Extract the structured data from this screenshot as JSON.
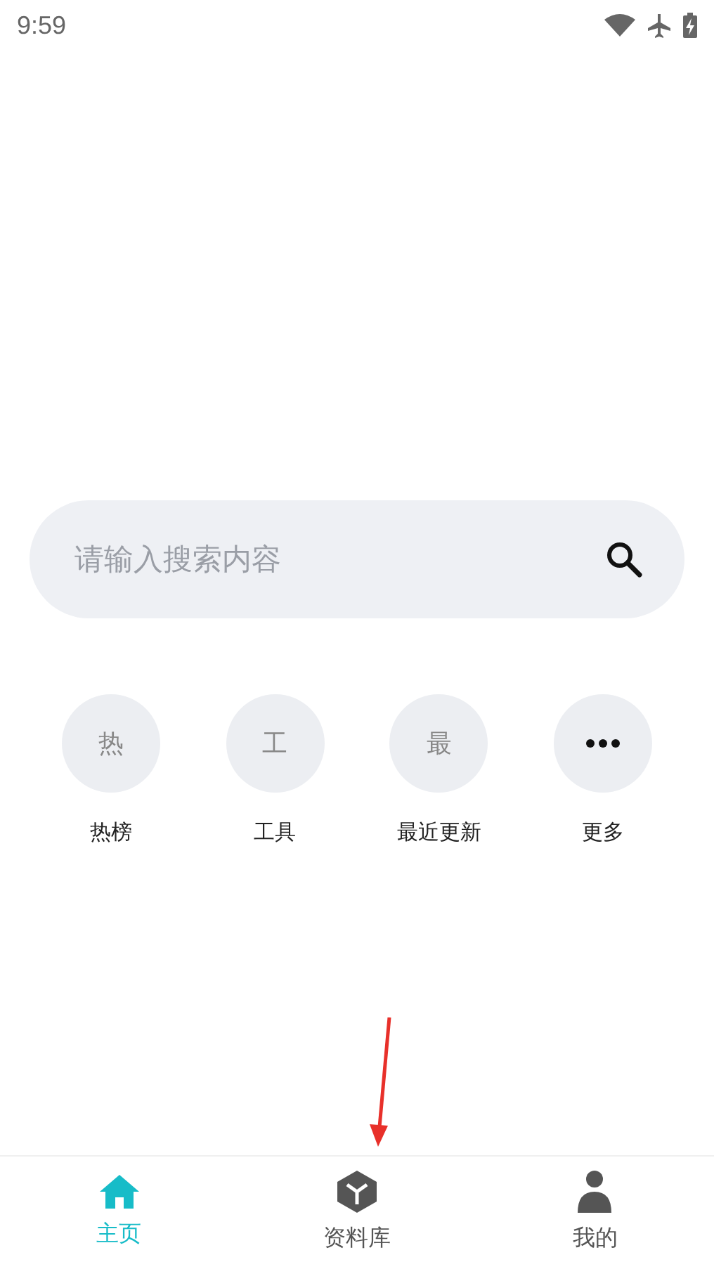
{
  "status_bar": {
    "time": "9:59"
  },
  "search": {
    "placeholder": "请输入搜索内容"
  },
  "shortcuts": [
    {
      "kind": "text",
      "glyph": "热",
      "label": "热榜"
    },
    {
      "kind": "text",
      "glyph": "工",
      "label": "工具"
    },
    {
      "kind": "text",
      "glyph": "最",
      "label": "最近更新"
    },
    {
      "kind": "more",
      "label": "更多"
    }
  ],
  "annotation": {
    "kind": "arrow"
  },
  "tabs": [
    {
      "kind": "home",
      "label": "主页",
      "selected": true
    },
    {
      "kind": "cube",
      "label": "资料库",
      "selected": false
    },
    {
      "kind": "person",
      "label": "我的",
      "selected": false
    }
  ]
}
